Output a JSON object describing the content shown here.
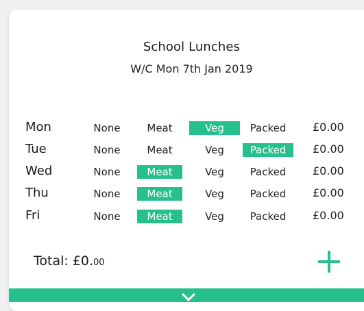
{
  "card": {
    "title": "School Lunches",
    "subtitle": "W/C Mon 7th Jan 2019"
  },
  "options": [
    "None",
    "Meat",
    "Veg",
    "Packed"
  ],
  "days": [
    {
      "label": "Mon",
      "selected": "Veg",
      "price": "£0.00"
    },
    {
      "label": "Tue",
      "selected": "Packed",
      "price": "£0.00"
    },
    {
      "label": "Wed",
      "selected": "Meat",
      "price": "£0.00"
    },
    {
      "label": "Thu",
      "selected": "Meat",
      "price": "£0.00"
    },
    {
      "label": "Fri",
      "selected": "Meat",
      "price": "£0.00"
    }
  ],
  "total": {
    "label": "Total: £0.",
    "pence": "00"
  },
  "icons": {
    "add": "plus-icon",
    "expand": "chevron-down-icon"
  },
  "colors": {
    "accent": "#26c08c",
    "background": "#eef0f1",
    "card": "#ffffff"
  }
}
